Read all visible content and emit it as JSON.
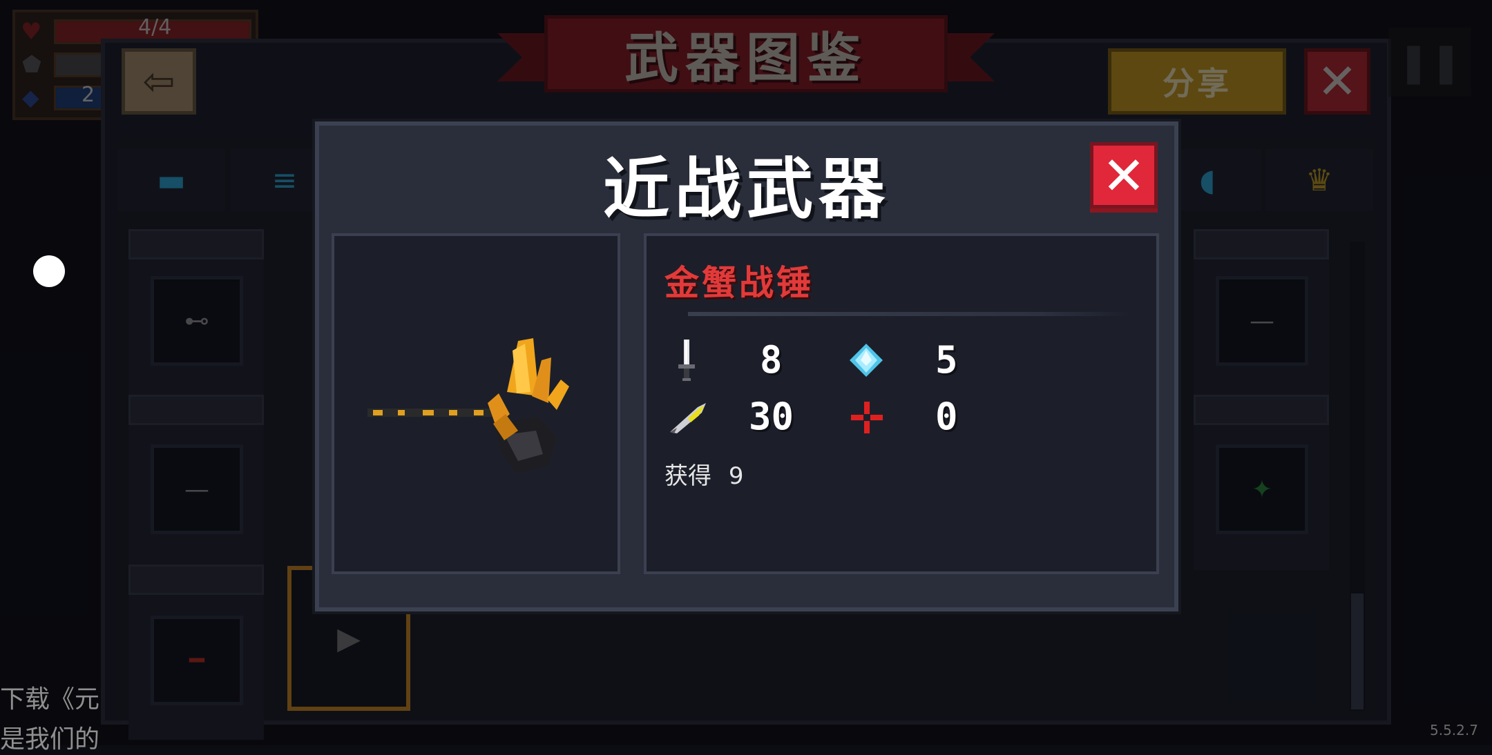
{
  "codex": {
    "title": "武器图鉴",
    "share_label": "分享",
    "back_glyph": "⇦",
    "close_glyph": "✕"
  },
  "modal": {
    "title": "近战武器",
    "close_glyph": "✕",
    "weapon_name": "金蟹战锤",
    "stats": {
      "damage": "8",
      "energy": "5",
      "crit": "30",
      "spread": "0"
    },
    "obtain_label": "获得",
    "obtain_count": "9"
  },
  "hud": {
    "hp_text": "4/4",
    "energy_text": "2"
  },
  "ticker": {
    "line1": "下载《元",
    "line2": "是我们的"
  },
  "version": "5.5.2.7",
  "colors": {
    "weapon_name": "#e23a3a",
    "share": "#c79a1c",
    "close_red": "#e0283a",
    "ribbon": "#8b1a22"
  },
  "icons": {
    "damage": "sword-icon",
    "energy": "diamond-icon",
    "crit": "feather-icon",
    "spread": "crosshair-icon"
  }
}
